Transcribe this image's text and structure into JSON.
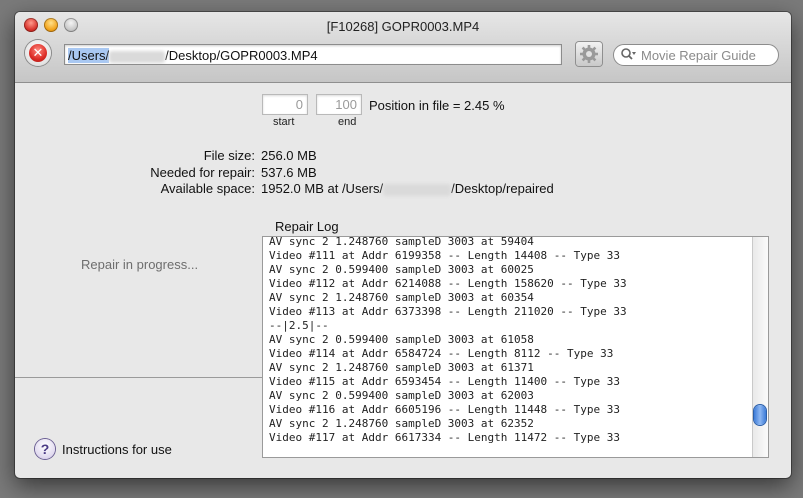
{
  "window": {
    "title": "[F10268] GOPR0003.MP4"
  },
  "toolbar": {
    "path_prefix": "/Users/",
    "path_redacted": "redacted",
    "path_suffix": "/Desktop/GOPR0003.MP4",
    "search_placeholder": "Movie Repair Guide",
    "stop_label": "✕"
  },
  "position": {
    "start_value": "0",
    "end_value": "100",
    "start_label": "start",
    "end_label": "end",
    "text": "Position in file = 2.45 %"
  },
  "info": {
    "file_size_label": "File size:",
    "file_size_value": "256.0 MB",
    "needed_label": "Needed for repair:",
    "needed_value": "537.6 MB",
    "available_label": "Available space:",
    "available_prefix": "1952.0 MB at /Users/",
    "available_redacted": "redacted",
    "available_suffix": "/Desktop/repaired"
  },
  "status": {
    "progress": "Repair in progress..."
  },
  "log": {
    "title": "Repair Log",
    "lines": [
      "AV sync 2 1.248760 sampleD 3003 at 59404",
      "Video #111 at Addr 6199358 -- Length 14408 -- Type 33",
      "AV sync 2 0.599400 sampleD 3003 at 60025",
      "Video #112 at Addr 6214088 -- Length 158620 -- Type 33",
      "AV sync 2 1.248760 sampleD 3003 at 60354",
      "Video #113 at Addr 6373398 -- Length 211020 -- Type 33",
      "--|2.5|--",
      "AV sync 2 0.599400 sampleD 3003 at 61058",
      "Video #114 at Addr 6584724 -- Length 8112 -- Type 33",
      "AV sync 2 1.248760 sampleD 3003 at 61371",
      "Video #115 at Addr 6593454 -- Length 11400 -- Type 33",
      "AV sync 2 0.599400 sampleD 3003 at 62003",
      "Video #116 at Addr 6605196 -- Length 11448 -- Type 33",
      "AV sync 2 1.248760 sampleD 3003 at 62352",
      "Video #117 at Addr 6617334 -- Length 11472 -- Type 33"
    ]
  },
  "help": {
    "icon": "?",
    "label": "Instructions for use"
  }
}
